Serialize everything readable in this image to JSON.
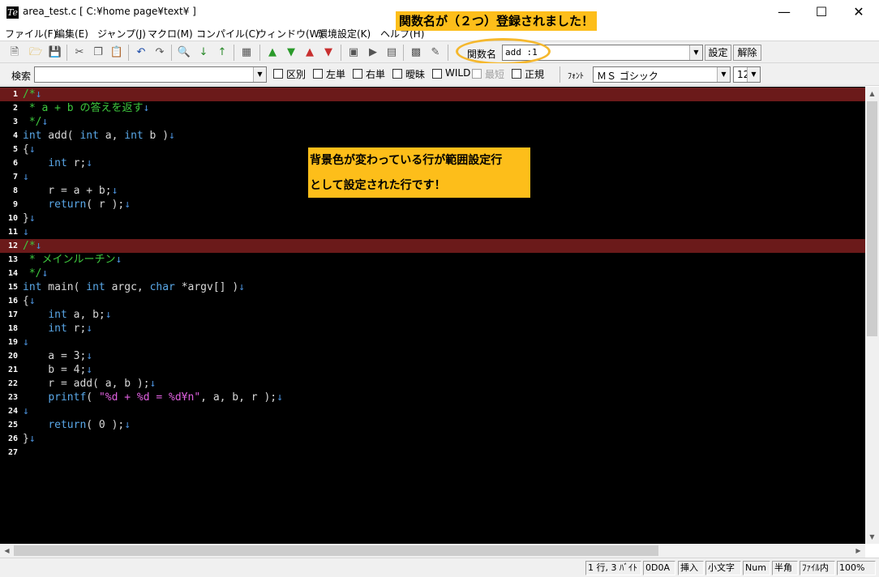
{
  "window": {
    "title": "area_test.c [ C:¥home page¥text¥ ]",
    "app_icon_text": "Te"
  },
  "menu": [
    "ファイル(F)",
    "編集(E)",
    "ジャンプ(J)",
    "マクロ(M)",
    "コンパイル(C)",
    "ウィンドウ(W)",
    "環境設定(K)",
    "ヘルプ(H)"
  ],
  "function_bar": {
    "label": "関数名",
    "selected": "add :1",
    "set_button": "設定",
    "clear_button": "解除"
  },
  "search_bar": {
    "label": "検索",
    "value": "",
    "options": {
      "region": "区別",
      "left": "左単",
      "right": "右単",
      "fuzzy": "曖昧",
      "wild": "WILD",
      "shortest": "最短",
      "regex": "正規"
    },
    "font_label": "ﾌｫﾝﾄ",
    "font_value": "ＭＳ ゴシック",
    "size_value": "12"
  },
  "editor": {
    "lines": [
      {
        "n": "1",
        "range": true,
        "text": "/*↓"
      },
      {
        "n": "2",
        "text": " * a + b の答えを返す↓"
      },
      {
        "n": "3",
        "text": " */↓"
      },
      {
        "n": "4",
        "text": "int add( int a, int b )↓"
      },
      {
        "n": "5",
        "text": "{↓"
      },
      {
        "n": "6",
        "text": "    int r;↓"
      },
      {
        "n": "7",
        "text": "↓"
      },
      {
        "n": "8",
        "text": "    r = a + b;↓"
      },
      {
        "n": "9",
        "text": "    return( r );↓"
      },
      {
        "n": "10",
        "text": "}↓"
      },
      {
        "n": "11",
        "text": "↓"
      },
      {
        "n": "12",
        "range": true,
        "text": "/*↓"
      },
      {
        "n": "13",
        "text": " * メインルーチン↓"
      },
      {
        "n": "14",
        "text": " */↓"
      },
      {
        "n": "15",
        "text": "int main( int argc, char *argv[] )↓"
      },
      {
        "n": "16",
        "text": "{↓"
      },
      {
        "n": "17",
        "text": "    int a, b;↓"
      },
      {
        "n": "18",
        "text": "    int r;↓"
      },
      {
        "n": "19",
        "text": "↓"
      },
      {
        "n": "20",
        "text": "    a = 3;↓"
      },
      {
        "n": "21",
        "text": "    b = 4;↓"
      },
      {
        "n": "22",
        "text": "    r = add( a, b );↓"
      },
      {
        "n": "23",
        "text": "    printf( \"%d + %d = %d¥n\", a, b, r );↓"
      },
      {
        "n": "24",
        "text": "↓"
      },
      {
        "n": "25",
        "text": "    return( 0 );↓"
      },
      {
        "n": "26",
        "text": "}↓"
      },
      {
        "n": "27",
        "text": ""
      }
    ]
  },
  "annotations": {
    "top": "関数名が（２つ）登録されました！",
    "note_line1": "背景色が変わっている行が範囲設定行",
    "note_line2": "として設定された行です！"
  },
  "status": {
    "position": "1 行, 3 ﾊﾞｲﾄ",
    "newline": "0D0A",
    "insert": "挿入",
    "case": "小文字",
    "num": "Num",
    "width": "半角",
    "scope": "ﾌｧｲﾙ内",
    "zoom": "100%"
  },
  "colors": {
    "range_bg": "#6b1a1a",
    "comment": "#3ec83e",
    "keyword": "#5aa8e8",
    "string": "#e060e0",
    "eol": "#4a8fd8",
    "annotation": "#fdbe1a"
  }
}
